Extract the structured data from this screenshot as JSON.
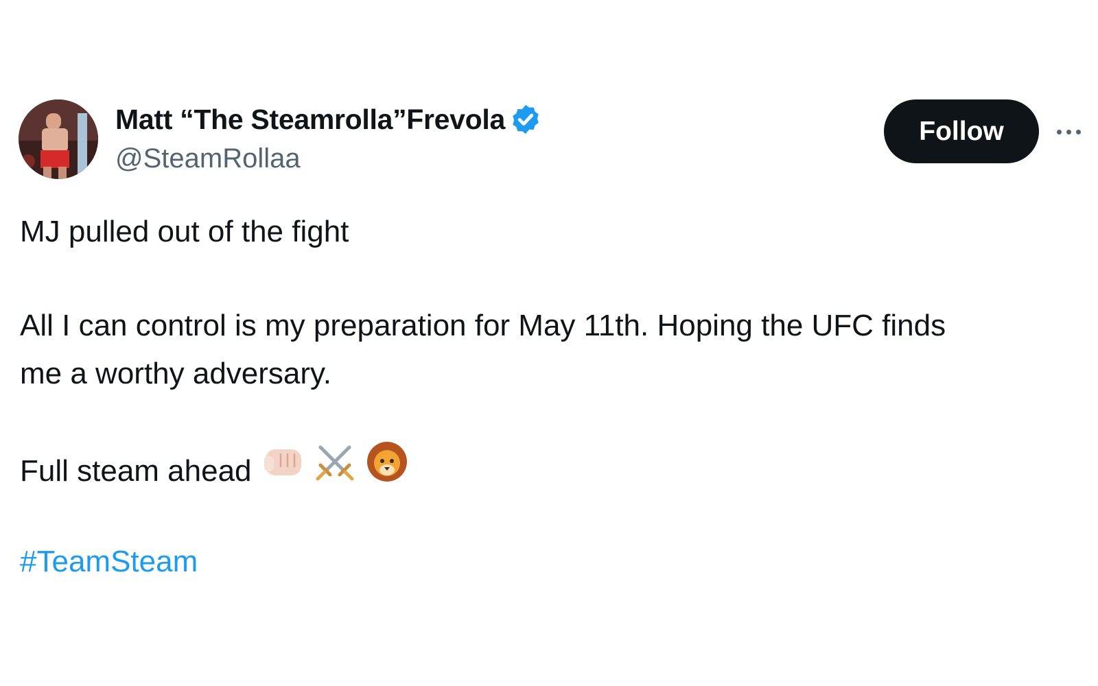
{
  "author": {
    "display_name": "Matt “The Steamrolla”Frevola",
    "handle": "@SteamRollaa",
    "verified": true
  },
  "follow_button": {
    "label": "Follow"
  },
  "tweet": {
    "line1": "MJ pulled out of the fight",
    "line2": "All I can control is my preparation for May 11th. Hoping the UFC finds",
    "line3": "me a worthy adversary.",
    "line4": "Full steam ahead",
    "emojis": [
      "fist-bump-icon",
      "crossed-swords-icon",
      "lion-icon"
    ],
    "hashtag": "#TeamSteam"
  },
  "colors": {
    "text": "#0f1419",
    "secondary": "#536471",
    "accent": "#1d9bf0",
    "button_bg": "#0f1419"
  }
}
